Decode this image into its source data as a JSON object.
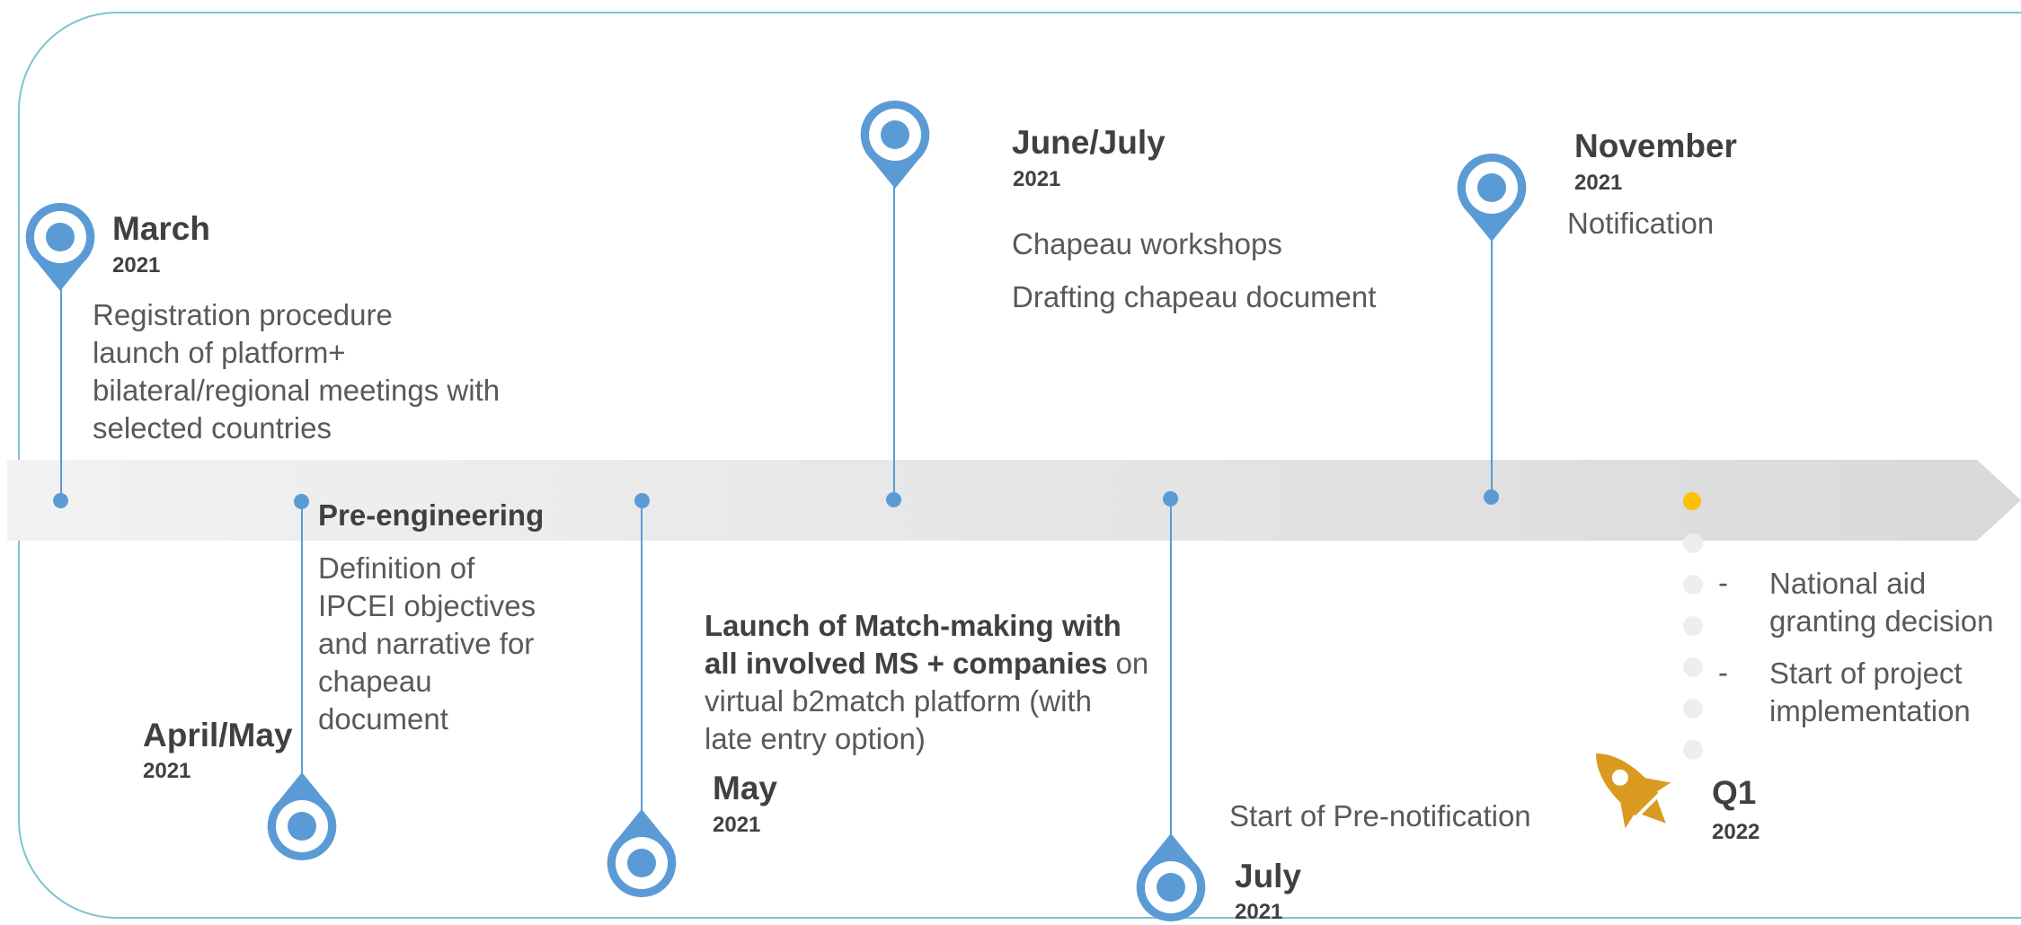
{
  "milestones": {
    "march": {
      "month": "March",
      "year": "2021",
      "lines": [
        "Registration procedure",
        "launch of platform+",
        "bilateral/regional meetings with",
        "selected countries"
      ]
    },
    "april_may": {
      "month": "April/May",
      "year": "2021",
      "heading": "Pre-engineering",
      "lines": [
        "Definition of",
        "IPCEI objectives",
        "and narrative for",
        "chapeau",
        "document"
      ]
    },
    "may": {
      "month": "May",
      "year": "2021",
      "bold_line1": "Launch of Match-making with",
      "bold_line2": "all involved MS + companies",
      "line2_rest": " on",
      "lines": [
        "virtual b2match platform (with",
        "late entry option)"
      ]
    },
    "june_july": {
      "month": "June/July",
      "year": "2021",
      "lines": [
        "Chapeau workshops",
        "Drafting chapeau document"
      ]
    },
    "july": {
      "month": "July",
      "year": "2021",
      "text": "Start of Pre-notification"
    },
    "november": {
      "month": "November",
      "year": "2021",
      "text": "Notification"
    },
    "q1": {
      "month": "Q1",
      "year": "2022",
      "bullets": [
        {
          "dash": "-",
          "lines": [
            "National aid",
            "granting decision"
          ]
        },
        {
          "dash": "-",
          "lines": [
            "Start of project",
            "implementation"
          ]
        }
      ]
    }
  },
  "colors": {
    "pin": "#5b9bd5",
    "frame": "#7cc3cf",
    "highlight_dot": "#ffc000",
    "rocket": "#d99a1f"
  },
  "icons": [
    "map-pin-icon",
    "rocket-icon"
  ]
}
